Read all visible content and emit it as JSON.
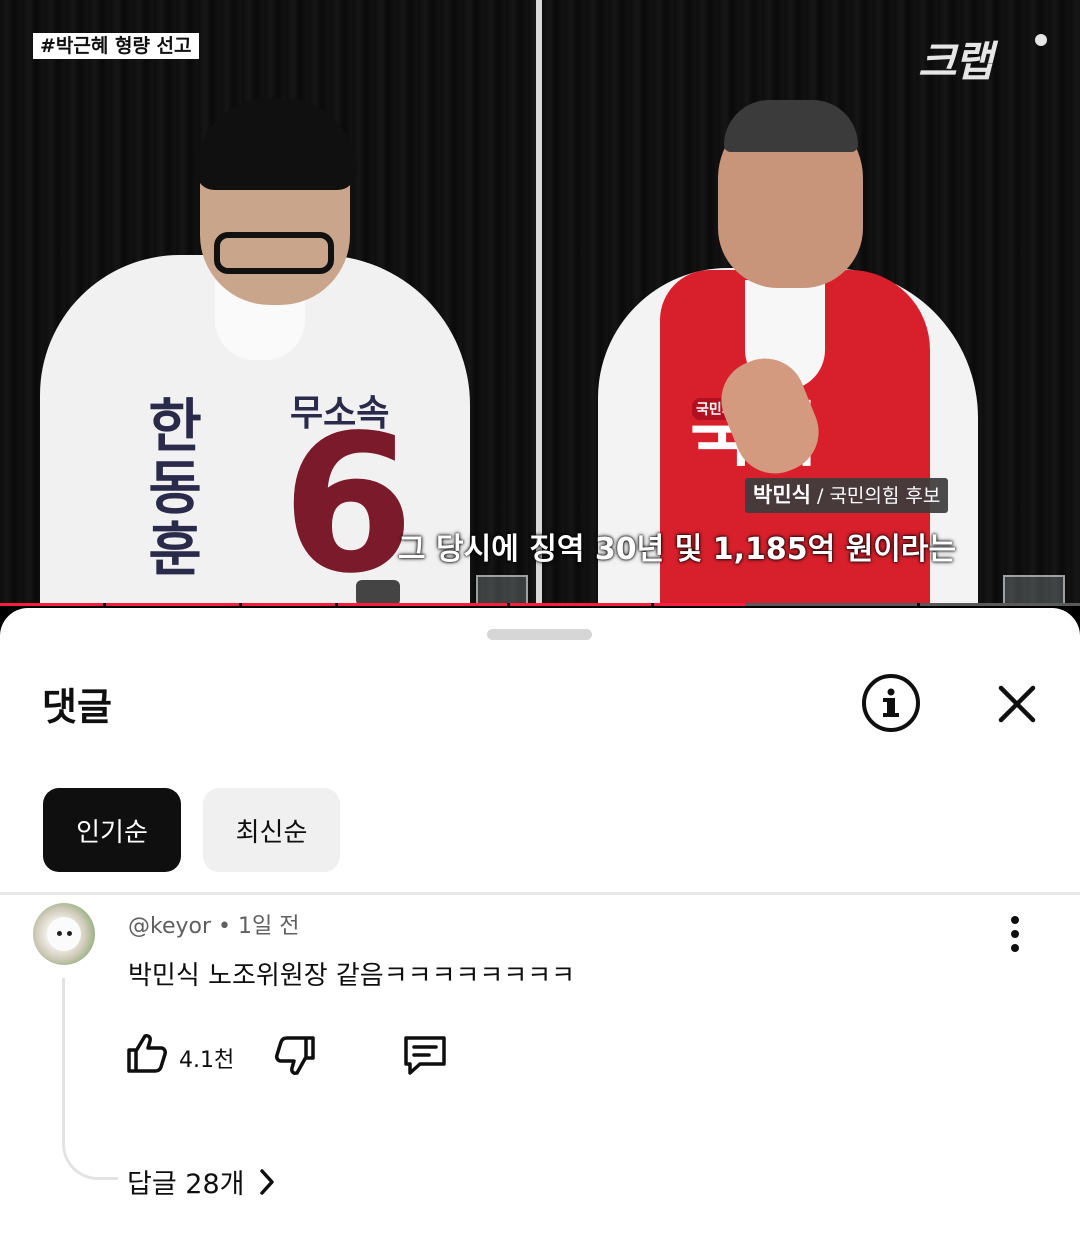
{
  "video": {
    "hashtag": "#박근혜 형량 선고",
    "channel_logo": "크랩",
    "left_candidate": {
      "name_vertical": "한동훈",
      "party_tag": "무소속",
      "number": "6"
    },
    "right_candidate": {
      "vest_text": "국회",
      "vest_party_small": "국민의",
      "name_caption": "박민식",
      "role_caption": "/ 국민의힘 후보"
    },
    "subtitle": "그 당시에 징역 30년 및 1,185억 원이라는",
    "progress_fraction": 0.69,
    "colors": {
      "progress": "#f5213c",
      "vest": "#d8202c",
      "left_number": "#7b1a2a"
    }
  },
  "sheet": {
    "title": "댓글",
    "info_icon": "info-circle-icon",
    "close_icon": "close-icon",
    "sort_chips": [
      {
        "label": "인기순",
        "active": true
      },
      {
        "label": "최신순",
        "active": false
      }
    ]
  },
  "comment": {
    "author": "@keyor",
    "time": "1일 전",
    "text": "박민식 노조위원장 같음ㅋㅋㅋㅋㅋㅋㅋㅋ",
    "like_count": "4.1천",
    "replies_label": "답글 28개",
    "icons": [
      "thumbs-up-icon",
      "thumbs-down-icon",
      "reply-icon",
      "more-vertical-icon",
      "chevron-right-icon"
    ]
  }
}
